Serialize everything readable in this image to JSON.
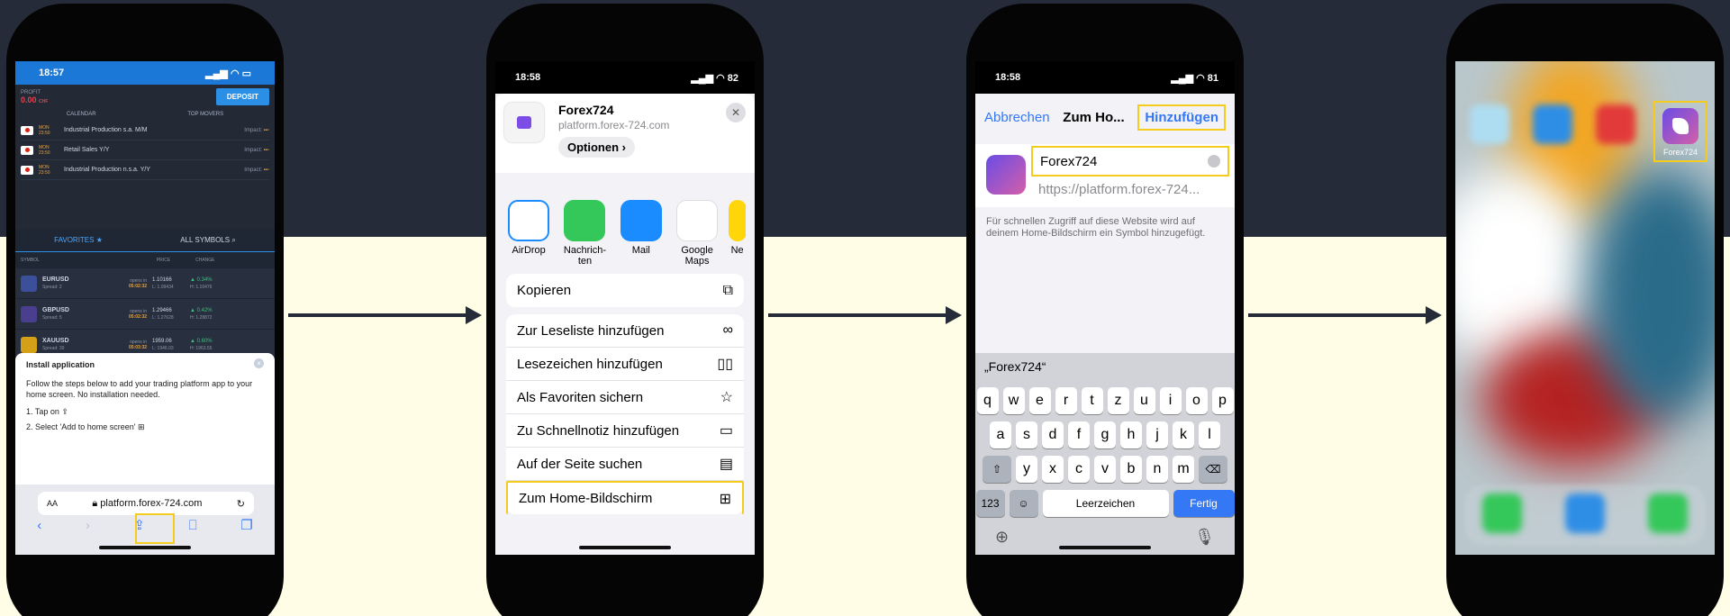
{
  "screen1": {
    "time": "18:57",
    "profit_label": "PROFIT",
    "profit_value": "0.00",
    "profit_currency": "CHF",
    "deposit": "DEPOSIT",
    "tab_calendar": "CALENDAR",
    "tab_top_movers": "TOP MOVERS",
    "calendar": [
      {
        "day": "MON",
        "time": "23:50",
        "event": "Industrial Production s.a. M/M",
        "impact": "Impact:"
      },
      {
        "day": "MON",
        "time": "23:50",
        "event": "Retail Sales Y/Y",
        "impact": "Impact:"
      },
      {
        "day": "MON",
        "time": "23:50",
        "event": "Industrial Production n.s.a. Y/Y",
        "impact": "Impact:"
      }
    ],
    "favorites": "FAVORITES",
    "all_symbols": "ALL SYMBOLS",
    "col_symbol": "SYMBOL",
    "col_price": "PRICE",
    "col_change": "CHANGE",
    "symbols": [
      {
        "name": "EURUSD",
        "spread": "Spread: 2",
        "opens_in": "opens in",
        "opens_time": "05:02:32",
        "price": "1.10166",
        "low": "L: 1.09434",
        "change": "▲ 0.34%",
        "high": "H: 1.10476",
        "color": "#3b4f9a"
      },
      {
        "name": "GBPUSD",
        "spread": "Spread: 5",
        "opens_in": "opens in",
        "opens_time": "05:02:32",
        "price": "1.29466",
        "low": "L: 1.27628",
        "change": "▲ 0.42%",
        "high": "H: 1.28872",
        "color": "#4a3f8f"
      },
      {
        "name": "XAUUSD",
        "spread": "Spread: 39",
        "opens_in": "opens in",
        "opens_time": "05:03:32",
        "price": "1959.06",
        "low": "L: 1946.03",
        "change": "▲ 0.60%",
        "high": "H: 1963.55",
        "color": "#d4a017"
      }
    ],
    "install_title": "Install application",
    "install_text": "Follow the steps below to add your trading platform app to your home screen. No installation needed.",
    "step1": "1. Tap on",
    "step2": "2. Select 'Add to home screen'",
    "url_aa": "AA",
    "url": "platform.forex-724.com"
  },
  "screen2": {
    "time": "18:58",
    "battery": "82",
    "app_title": "Forex724",
    "app_url": "platform.forex-724.com",
    "options": "Optionen",
    "share_apps": [
      {
        "label": "AirDrop",
        "color": "#ffffff"
      },
      {
        "label": "Nachrich-ten",
        "color": "#34c759"
      },
      {
        "label": "Mail",
        "color": "#1a8cff"
      },
      {
        "label": "Google Maps",
        "color": "#ffffff"
      },
      {
        "label": "Ne",
        "color": "#ffd60a"
      }
    ],
    "copy": "Kopieren",
    "actions": [
      {
        "label": "Zur Leseliste hinzufügen",
        "icon": "∞"
      },
      {
        "label": "Lesezeichen hinzufügen",
        "icon": "▯▯"
      },
      {
        "label": "Als Favoriten sichern",
        "icon": "☆"
      },
      {
        "label": "Zu Schnellnotiz hinzufügen",
        "icon": "▭"
      },
      {
        "label": "Auf der Seite suchen",
        "icon": "▤"
      },
      {
        "label": "Zum Home-Bildschirm",
        "icon": "⊞"
      }
    ]
  },
  "screen3": {
    "time": "18:58",
    "battery": "81",
    "cancel": "Abbrechen",
    "title": "Zum Ho...",
    "add": "Hinzufügen",
    "name_value": "Forex724",
    "url": "https://platform.forex-724...",
    "note": "Für schnellen Zugriff auf diese Website wird auf deinem Home-Bildschirm ein Symbol hinzugefügt.",
    "suggestion": "„Forex724“",
    "row1": [
      "q",
      "w",
      "e",
      "r",
      "t",
      "z",
      "u",
      "i",
      "o",
      "p"
    ],
    "row2": [
      "a",
      "s",
      "d",
      "f",
      "g",
      "h",
      "j",
      "k",
      "l"
    ],
    "row3": [
      "y",
      "x",
      "c",
      "v",
      "b",
      "n",
      "m"
    ],
    "key_123": "123",
    "space": "Leerzeichen",
    "done": "Fertig"
  },
  "screen4": {
    "app_label": "Forex724"
  }
}
